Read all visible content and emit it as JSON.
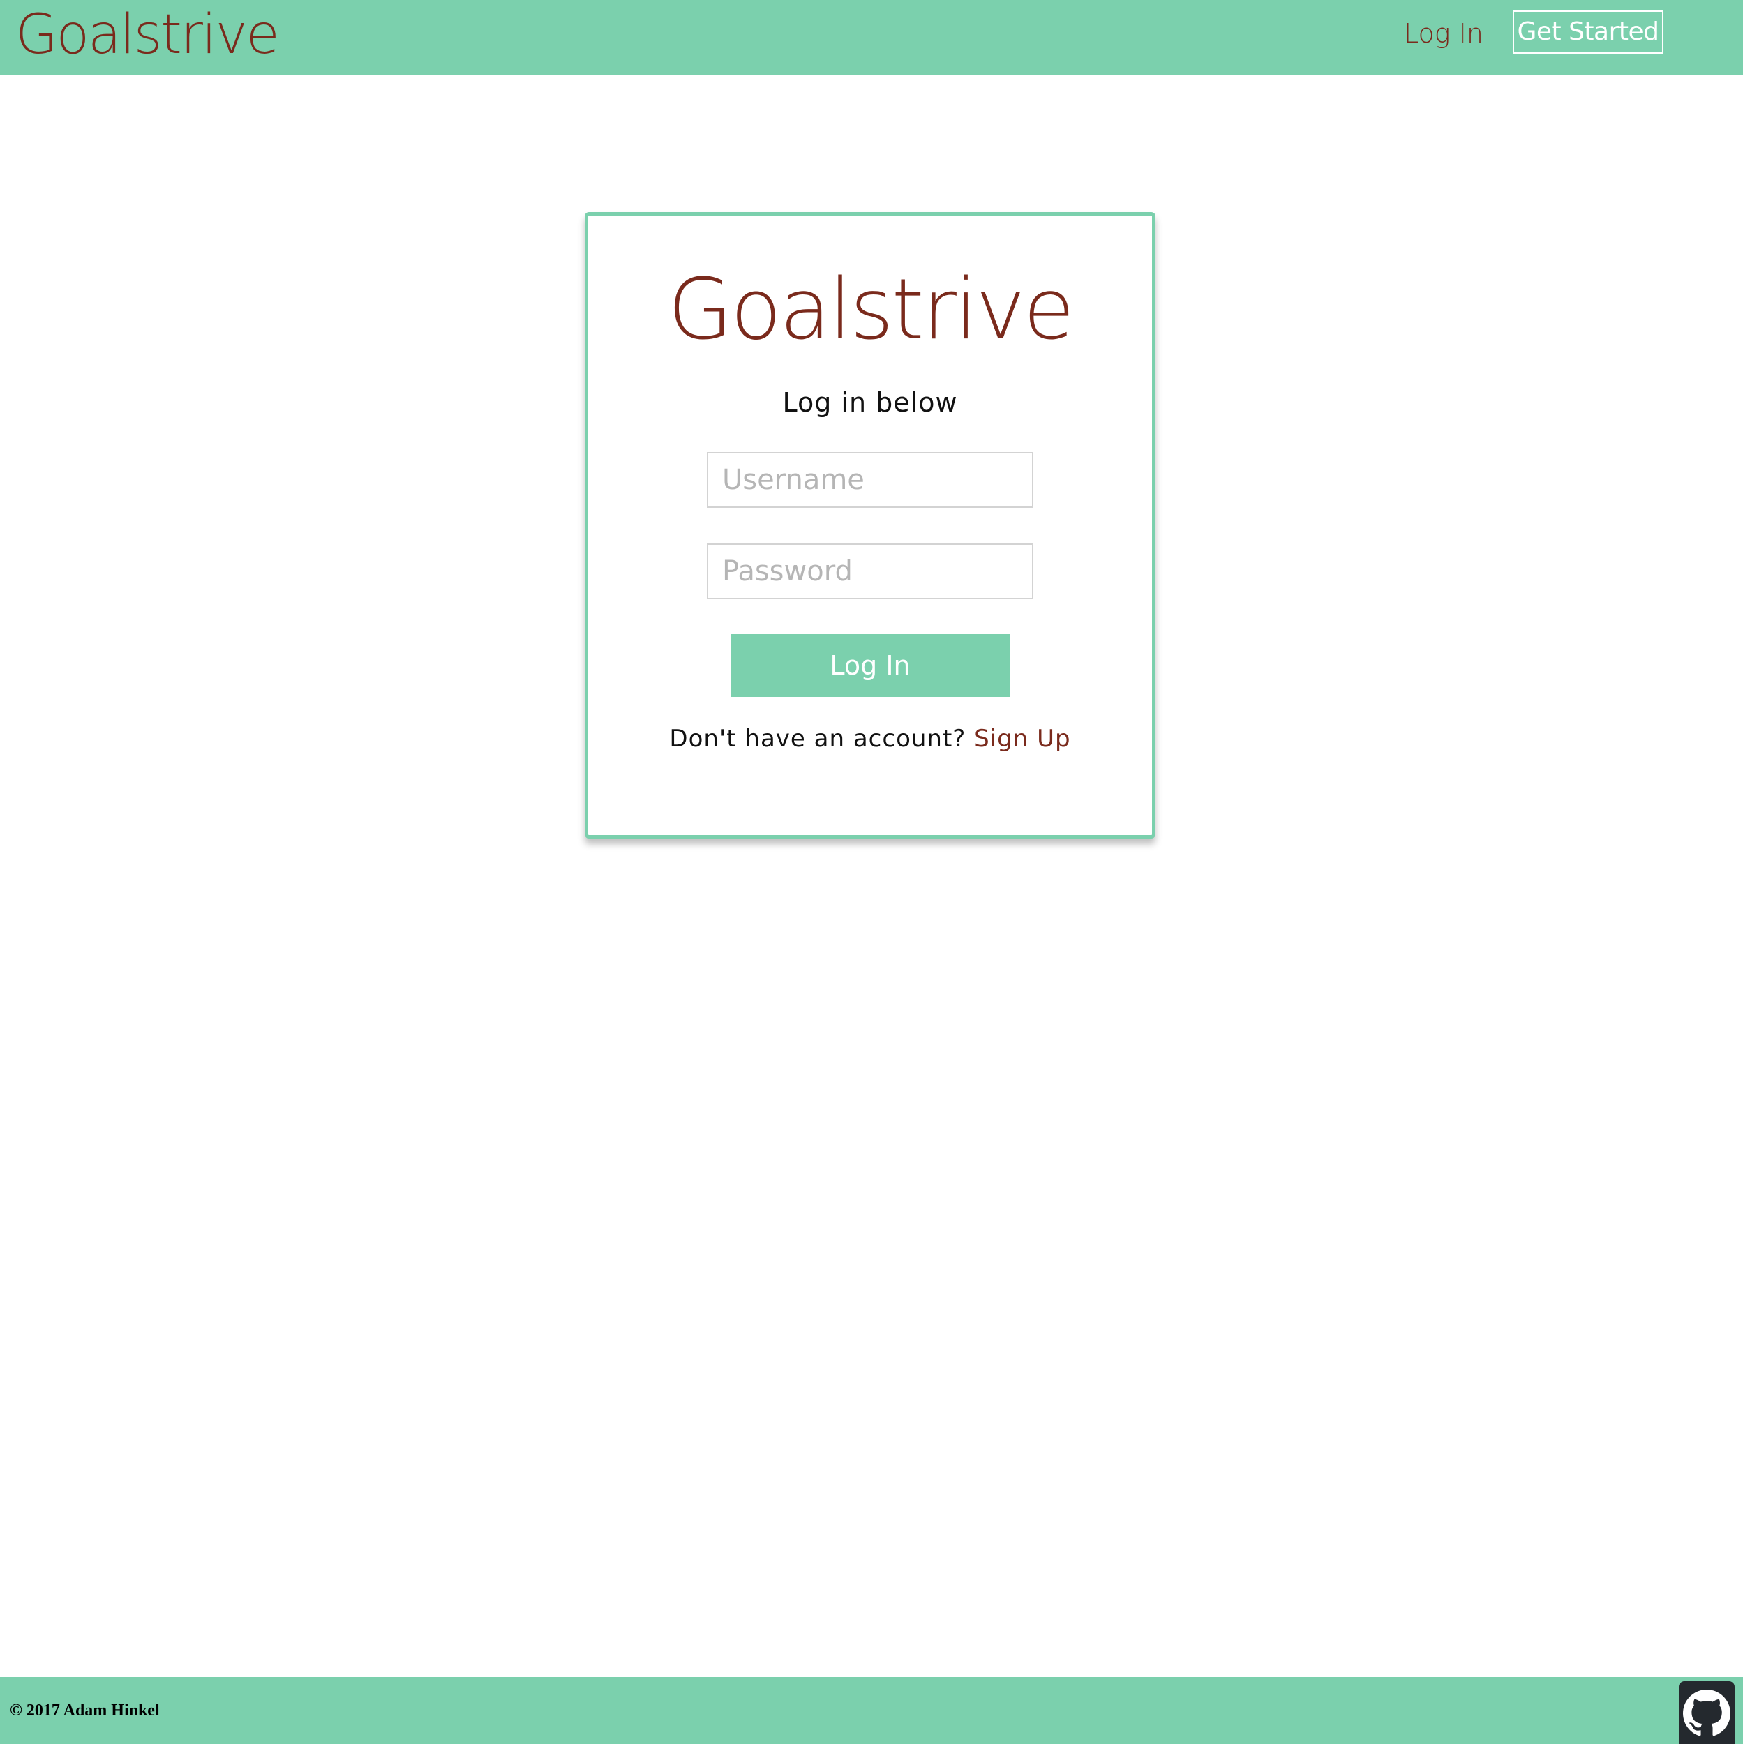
{
  "header": {
    "brand": "Goalstrive",
    "nav": {
      "login_label": "Log In",
      "get_started_label": "Get Started"
    }
  },
  "login_card": {
    "logo": "Goalstrive",
    "subtitle": "Log in below",
    "username_placeholder": "Username",
    "password_placeholder": "Password",
    "submit_label": "Log In",
    "signup_prompt": "Don't have an account?",
    "signup_link_label": "Sign Up"
  },
  "footer": {
    "copyright": "© 2017 Adam Hinkel",
    "github_icon": "github-icon"
  },
  "colors": {
    "accent": "#7bd0ad",
    "brand": "#7a2a1c",
    "text": "#111111",
    "placeholder": "#b5b5b5",
    "github_bg": "#24292e"
  }
}
